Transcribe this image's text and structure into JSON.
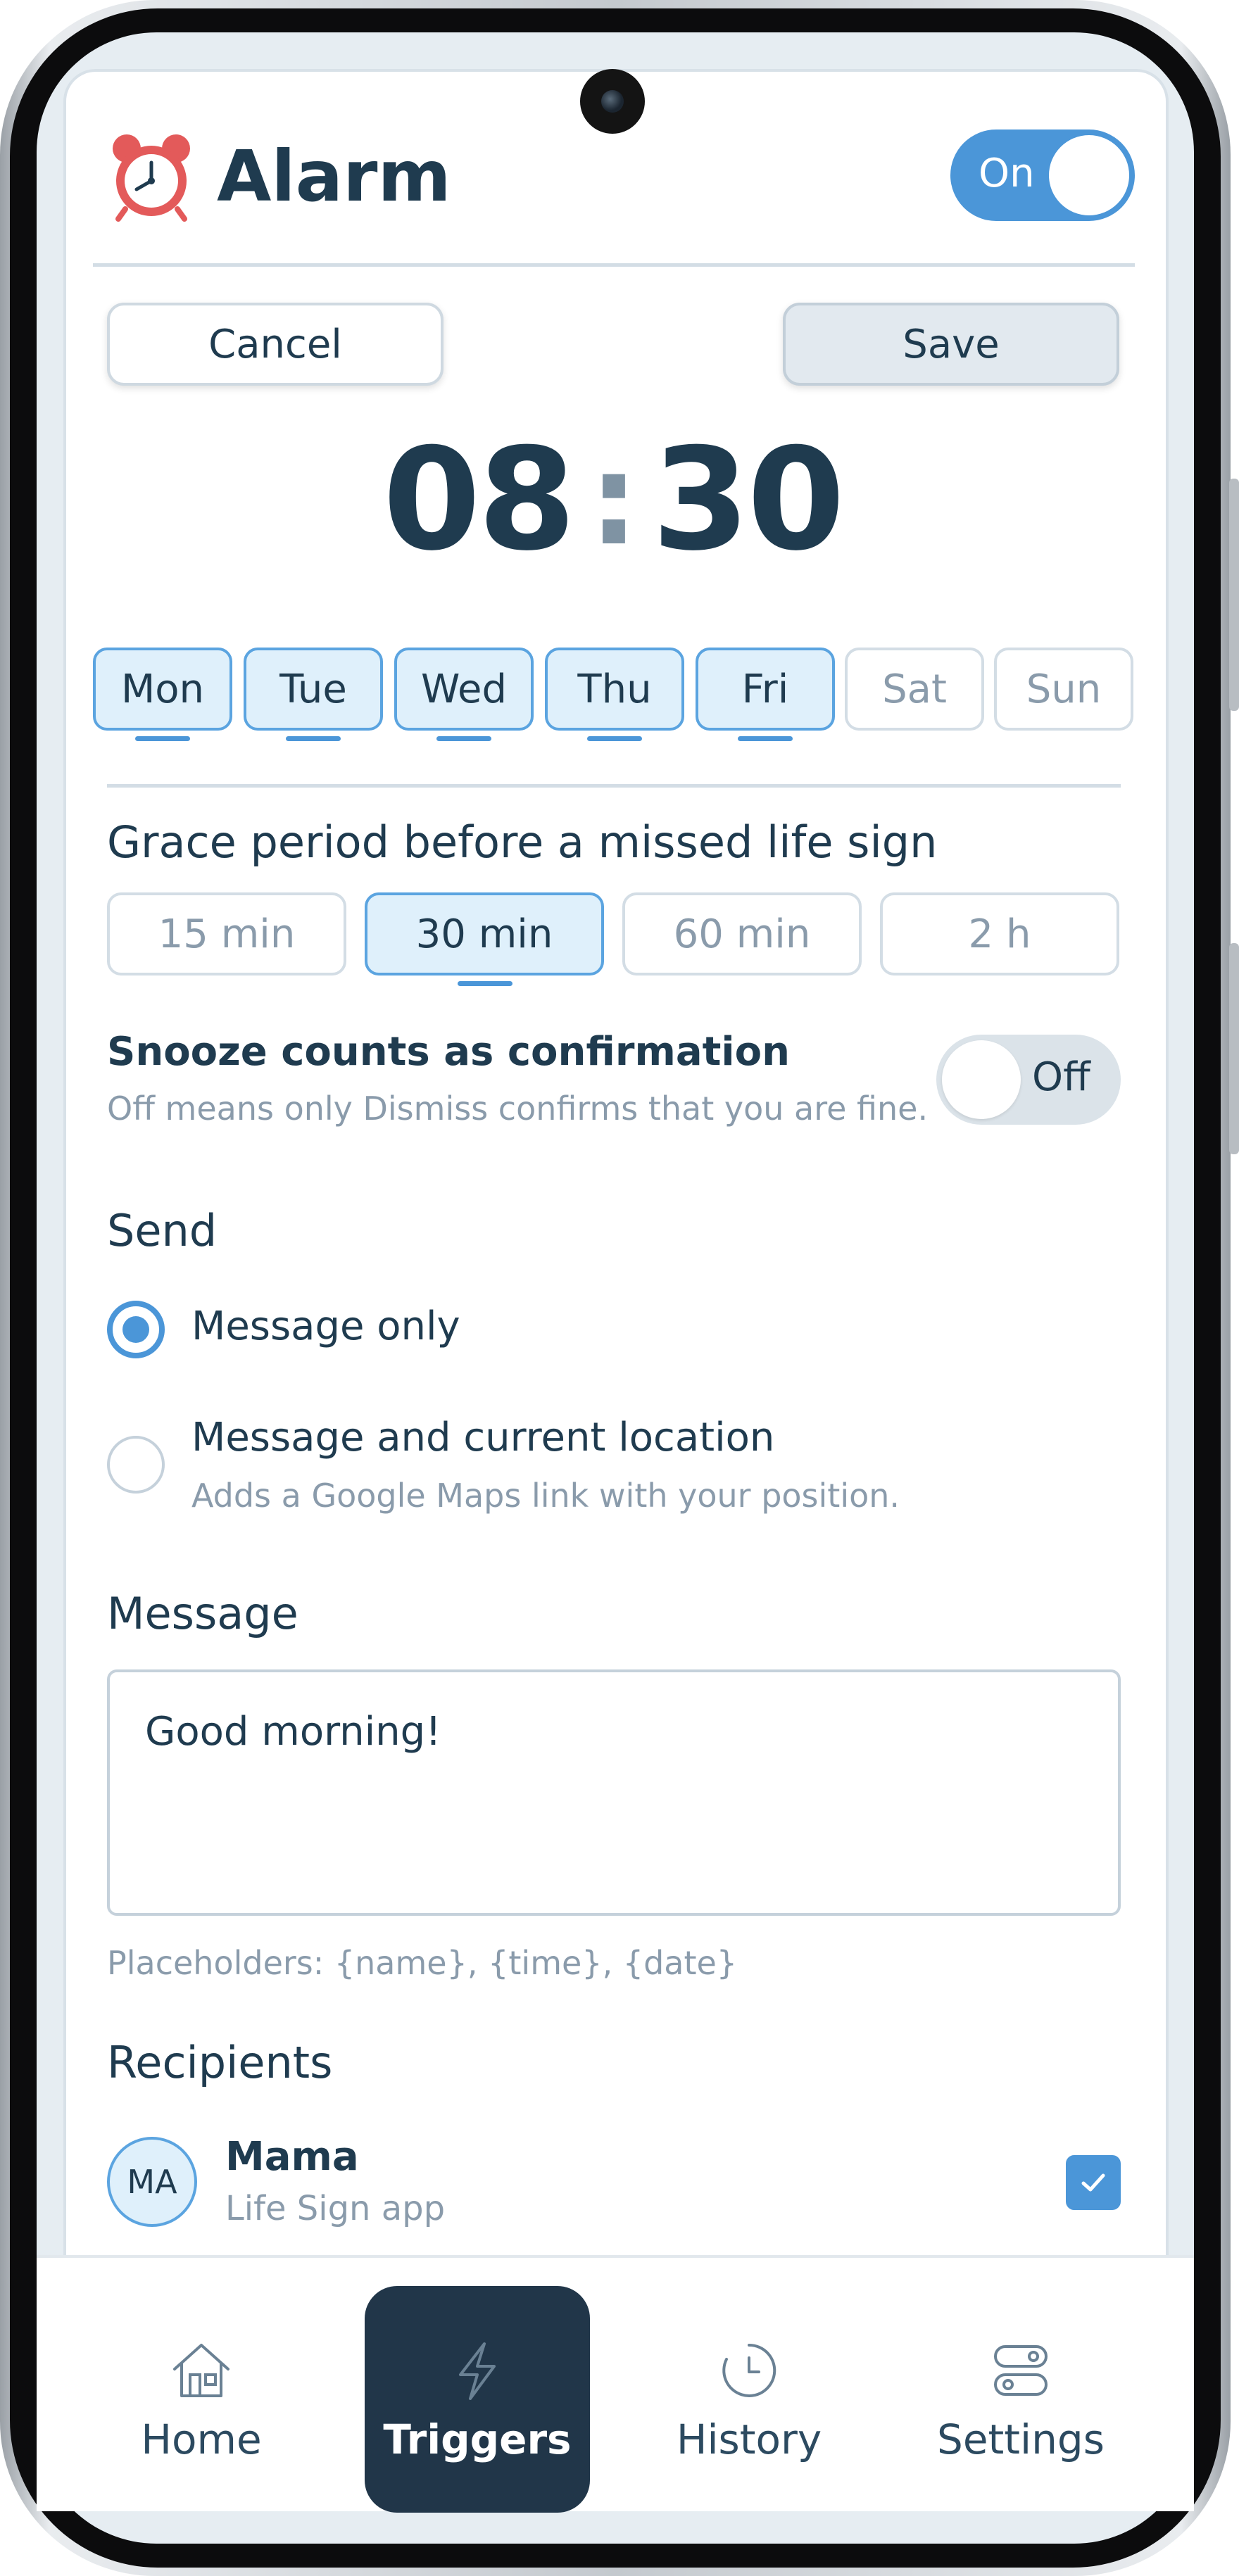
{
  "header": {
    "title": "Alarm",
    "icon": "alarm-clock-icon",
    "toggle_label": "On"
  },
  "actions": {
    "cancel_label": "Cancel",
    "save_label": "Save"
  },
  "time": {
    "hours": "08",
    "separator": ":",
    "minutes": "30"
  },
  "days": [
    {
      "label": "Mon",
      "selected": true
    },
    {
      "label": "Tue",
      "selected": true
    },
    {
      "label": "Wed",
      "selected": true
    },
    {
      "label": "Thu",
      "selected": true
    },
    {
      "label": "Fri",
      "selected": true
    },
    {
      "label": "Sat",
      "selected": false
    },
    {
      "label": "Sun",
      "selected": false
    }
  ],
  "grace": {
    "title": "Grace period before a missed life sign",
    "options": [
      {
        "label": "15 min",
        "selected": false
      },
      {
        "label": "30 min",
        "selected": true
      },
      {
        "label": "60 min",
        "selected": false
      },
      {
        "label": "2 h",
        "selected": false
      }
    ]
  },
  "snooze": {
    "title": "Snooze counts as confirmation",
    "subtitle": "Off means only Dismiss confirms that you are fine.",
    "toggle_label": "Off"
  },
  "send": {
    "title": "Send",
    "options": [
      {
        "label": "Message only",
        "checked": true,
        "subtitle": ""
      },
      {
        "label": "Message and current location",
        "checked": false,
        "subtitle": "Adds a Google Maps link with your position."
      }
    ]
  },
  "message": {
    "title": "Message",
    "value": "Good morning!",
    "hint": "Placeholders: {name}, {time}, {date}"
  },
  "recipients": {
    "title": "Recipients",
    "items": [
      {
        "initials": "MA",
        "name": "Mama",
        "subtitle": "Life Sign app",
        "checked": true
      }
    ]
  },
  "nav": {
    "items": [
      {
        "label": "Home",
        "icon": "home-icon",
        "active": false
      },
      {
        "label": "Triggers",
        "icon": "lightning-icon",
        "active": true
      },
      {
        "label": "History",
        "icon": "clock-icon",
        "active": false
      },
      {
        "label": "Settings",
        "icon": "toggles-icon",
        "active": false
      }
    ]
  },
  "colors": {
    "accent": "#4b96d8",
    "text": "#1f3b4f",
    "muted": "#8a9bab",
    "nav_active": "#213649"
  }
}
